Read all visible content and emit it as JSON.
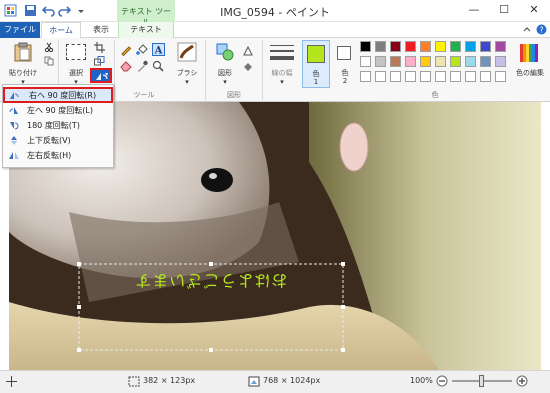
{
  "window": {
    "title": "IMG_0594 - ペイント",
    "context_tab_group": "テキスト ツール",
    "minimize": "—",
    "maximize": "☐",
    "close": "✕"
  },
  "tabs": [
    {
      "label": "ファイル"
    },
    {
      "label": "ホーム"
    },
    {
      "label": "表示"
    },
    {
      "label": "テキスト"
    }
  ],
  "ribbon": {
    "paste_label": "貼り付け",
    "select_label": "選択",
    "brush_label": "ブラシ",
    "shapes_label": "図形",
    "line_width_label": "線の幅",
    "color1_label": "色",
    "color1_num": "1",
    "color2_label": "色",
    "color2_num": "2",
    "edit_colors_label": "色の編集",
    "groups": {
      "tools": "ツール",
      "shapes": "図形",
      "colors": "色"
    },
    "color1_value": "#b5e61d",
    "color2_value": "#ffffff",
    "palette_row1": [
      "#000000",
      "#7f7f7f",
      "#880015",
      "#ed1c24",
      "#ff7f27",
      "#fff200",
      "#22b14c",
      "#00a2e8",
      "#3f48cc",
      "#a349a4"
    ],
    "palette_row2": [
      "#ffffff",
      "#c3c3c3",
      "#b97a57",
      "#ffaec9",
      "#ffc90e",
      "#efe4b0",
      "#b5e61d",
      "#99d9ea",
      "#7092be",
      "#c8bfe7"
    ]
  },
  "rotate_menu": {
    "items": [
      {
        "label": "右へ 90 度回転(R)",
        "icon": "rotate-right-icon"
      },
      {
        "label": "左へ 90 度回転(L)",
        "icon": "rotate-left-icon"
      },
      {
        "label": "180 度回転(T)",
        "icon": "rotate-180-icon"
      },
      {
        "label": "上下反転(V)",
        "icon": "flip-vertical-icon"
      },
      {
        "label": "左右反転(H)",
        "icon": "flip-horizontal-icon"
      }
    ]
  },
  "canvas": {
    "text_on_image": "おはようございます"
  },
  "status": {
    "selection_size": "382 × 123px",
    "image_size": "768 × 1024px",
    "zoom": "100%",
    "zoom_level_percent": 50
  }
}
